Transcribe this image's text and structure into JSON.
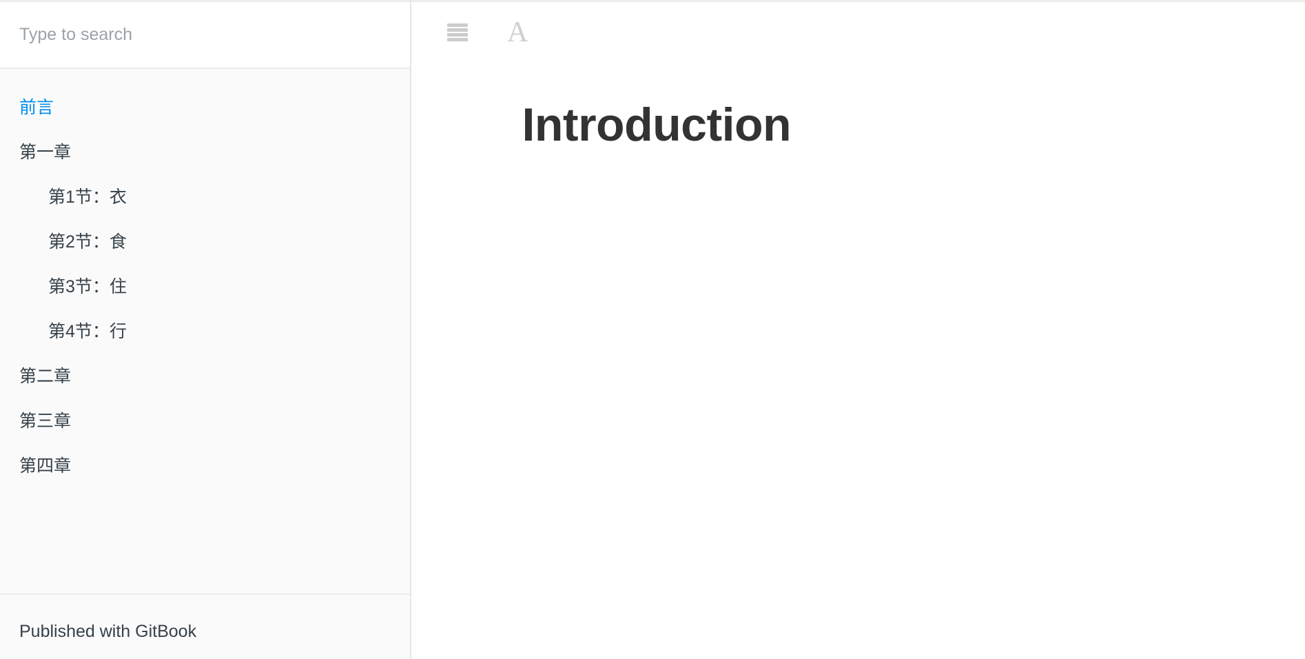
{
  "sidebar": {
    "search": {
      "placeholder": "Type to search",
      "value": ""
    },
    "nav_items": [
      {
        "label": "前言",
        "level": 1,
        "active": true
      },
      {
        "label": "第一章",
        "level": 1,
        "active": false
      },
      {
        "label": "第1节：衣",
        "level": 2,
        "active": false
      },
      {
        "label": "第2节：食",
        "level": 2,
        "active": false
      },
      {
        "label": "第3节：住",
        "level": 2,
        "active": false
      },
      {
        "label": "第4节：行",
        "level": 2,
        "active": false
      },
      {
        "label": "第二章",
        "level": 1,
        "active": false
      },
      {
        "label": "第三章",
        "level": 1,
        "active": false
      },
      {
        "label": "第四章",
        "level": 1,
        "active": false
      }
    ],
    "footer": {
      "published_with": "Published with GitBook"
    }
  },
  "toolbar": {
    "menu_icon": "hamburger-menu-icon",
    "font_settings_icon": "font-size-icon",
    "font_settings_glyph": "A"
  },
  "main": {
    "page_title": "Introduction"
  },
  "colors": {
    "accent": "#008cf0",
    "text": "#364149",
    "heading": "#333333",
    "sidebar_bg": "#fafafa",
    "icon": "#cccccc",
    "placeholder": "#9aa2a9"
  }
}
